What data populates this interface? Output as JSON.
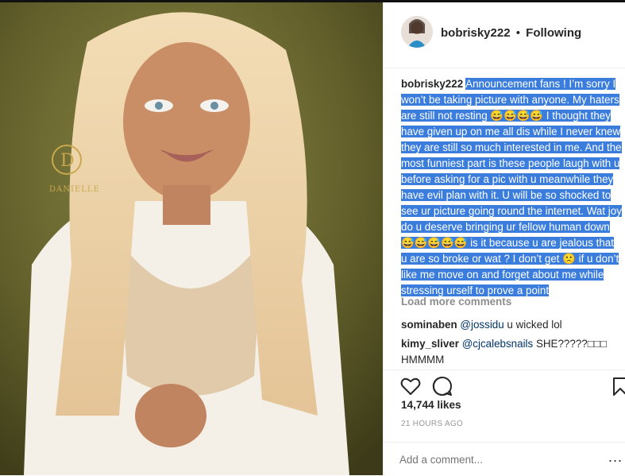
{
  "post": {
    "username": "bobrisky222",
    "separator": "•",
    "follow_status": "Following",
    "caption_user": "bobrisky222",
    "caption_text": "Announcement fans ! I’m sorry I won’t be taking picture with anyone. My haters are still not resting 😅😅😅😅 I thought they have given up on me all dis while I never knew they are still so much interested in me. And the most funniest part is these people laugh with u before asking for a pic with u meanwhile they have evil plan with it. U will be so shocked to see ur picture going round the internet. Wat joy do u deserve bringing ur fellow human down 😅😅😅😅😅 is it because u are jealous that u are so broke or wat ? I don’t get 🙁 if u don’t like me move on and forget about me while stressing urself to prove a point",
    "load_more": "Load more comments",
    "watermark_text": "DANIELLE"
  },
  "comments": [
    {
      "user": "sominaben",
      "mention": "@jossidu",
      "text": " u wicked lol"
    },
    {
      "user": "kimy_sliver",
      "mention": "@cjcalebsnails",
      "text": " SHE?????□□□ HMMMM"
    }
  ],
  "stats": {
    "likes": "14,744 likes",
    "time": "21 HOURS AGO"
  },
  "add_comment": {
    "placeholder": "Add a comment...",
    "more_label": "..."
  },
  "icons": {
    "like": "heart-icon",
    "comment": "comment-bubble-icon",
    "save": "bookmark-icon",
    "options": "more-options-icon"
  },
  "colors": {
    "highlight": "#3b7ddd",
    "mention": "#003569",
    "muted": "#8e8e8e",
    "photo_background": "#6b6a32"
  }
}
